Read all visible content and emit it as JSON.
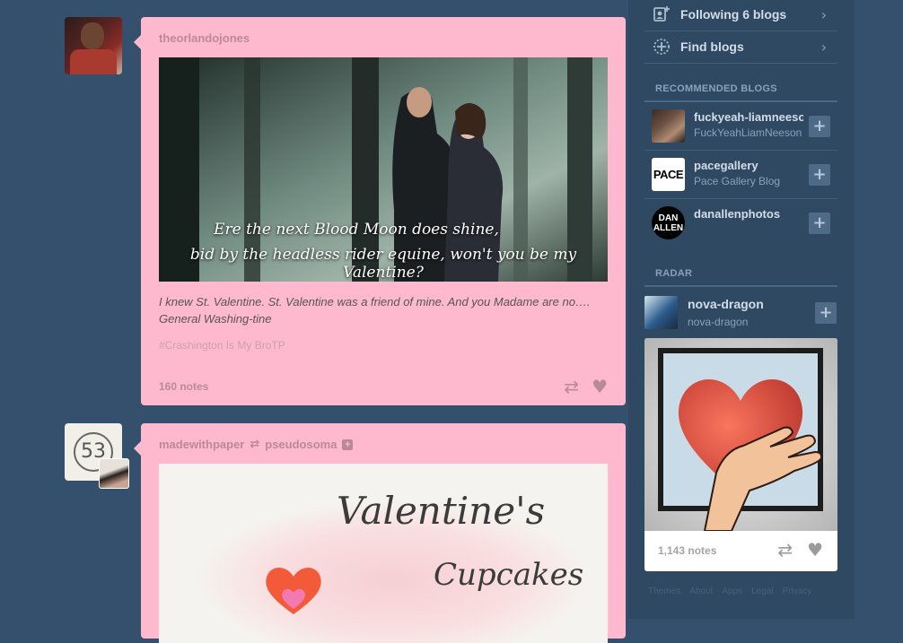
{
  "sidebar": {
    "nav": [
      {
        "label": "Following 6 blogs",
        "icon": "add-person-icon"
      },
      {
        "label": "Find blogs",
        "icon": "compass-icon"
      }
    ],
    "recommended_heading": "RECOMMENDED BLOGS",
    "recommended": [
      {
        "name": "fuckyeah-liamneeson",
        "subtitle": "FuckYeahLiamNeeson"
      },
      {
        "name": "pacegallery",
        "subtitle": "Pace Gallery Blog",
        "avatar_text": "PACE"
      },
      {
        "name": "danallenphotos",
        "subtitle": "",
        "avatar_text": "DAN ALLEN"
      }
    ],
    "radar_heading": "RADAR",
    "radar": {
      "name": "nova-dragon",
      "subtitle": "nova-dragon",
      "notes": "1,143 notes"
    },
    "footer_links": [
      "Themes",
      "About",
      "Apps",
      "Legal",
      "Privacy"
    ]
  },
  "posts": [
    {
      "author": "theorlandojones",
      "caption_line1": "Ere the next Blood Moon does shine,",
      "caption_line2": "bid by the headless rider equine, won't you be my Valentine?",
      "text": "I knew St. Valentine. St. Valentine was a friend of mine. And you Madame are no…. General Washing-tine",
      "tag": "#Crashington Is My BroTP",
      "notes": "160 notes"
    },
    {
      "author": "madewithpaper",
      "reblogged_from": "pseudosoma",
      "avatar_text": "53",
      "image_title": "Valentine's",
      "image_subtitle": "Cupcakes"
    }
  ],
  "colors": {
    "background": "#35506d",
    "post_card": "#ffb9ce",
    "sidebar_text": "#d3dde7"
  }
}
